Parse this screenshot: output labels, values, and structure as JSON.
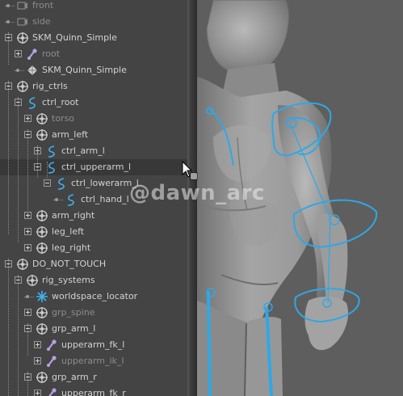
{
  "outliner": {
    "rows": [
      {
        "label": "front",
        "dim": true,
        "icon": "camera-icon"
      },
      {
        "label": "side",
        "dim": true,
        "icon": "camera-icon"
      },
      {
        "label": "SKM_Quinn_Simple",
        "dim": false,
        "icon": "transform-group-icon"
      },
      {
        "label": "root",
        "dim": true,
        "icon": "joint-icon"
      },
      {
        "label": "SKM_Quinn_Simple",
        "dim": false,
        "icon": "mesh-icon"
      },
      {
        "label": "rig_ctrls",
        "dim": false,
        "icon": "transform-group-icon"
      },
      {
        "label": "ctrl_root",
        "dim": false,
        "icon": "nurbs-curve-icon"
      },
      {
        "label": "torso",
        "dim": true,
        "icon": "transform-group-icon"
      },
      {
        "label": "arm_left",
        "dim": false,
        "icon": "transform-group-icon"
      },
      {
        "label": "ctrl_arm_l",
        "dim": false,
        "icon": "nurbs-curve-icon"
      },
      {
        "label": "ctrl_upperarm_l",
        "dim": false,
        "icon": "nurbs-curve-icon",
        "highlighted": true
      },
      {
        "label": "ctrl_lowerarm_l",
        "dim": false,
        "icon": "nurbs-curve-icon"
      },
      {
        "label": "ctrl_hand_l",
        "dim": false,
        "icon": "nurbs-curve-icon"
      },
      {
        "label": "arm_right",
        "dim": false,
        "icon": "transform-group-icon"
      },
      {
        "label": "leg_left",
        "dim": false,
        "icon": "transform-group-icon"
      },
      {
        "label": "leg_right",
        "dim": false,
        "icon": "transform-group-icon"
      },
      {
        "label": "DO_NOT_TOUCH",
        "dim": false,
        "icon": "transform-group-icon"
      },
      {
        "label": "rig_systems",
        "dim": false,
        "icon": "transform-group-icon"
      },
      {
        "label": "worldspace_locator",
        "dim": false,
        "icon": "locator-icon"
      },
      {
        "label": "grp_spine",
        "dim": true,
        "icon": "transform-group-icon"
      },
      {
        "label": "grp_arm_l",
        "dim": false,
        "icon": "transform-group-icon"
      },
      {
        "label": "upperarm_fk_l",
        "dim": false,
        "icon": "joint-icon"
      },
      {
        "label": "upperarm_ik_l",
        "dim": true,
        "icon": "joint-icon"
      },
      {
        "label": "grp_arm_r",
        "dim": false,
        "icon": "transform-group-icon"
      },
      {
        "label": "upperarm_fk_r",
        "dim": false,
        "icon": "joint-icon"
      }
    ]
  },
  "watermark": "@dawn_arc",
  "colors": {
    "panel_bg": "#444444",
    "row_highlight": "#383838",
    "text": "#d2d2d2",
    "text_dim": "#8c8c8c",
    "curve_blue": "#2ea8e6",
    "joint_purple": "#b7a0e8",
    "group_icon": "#cfcfcf"
  }
}
